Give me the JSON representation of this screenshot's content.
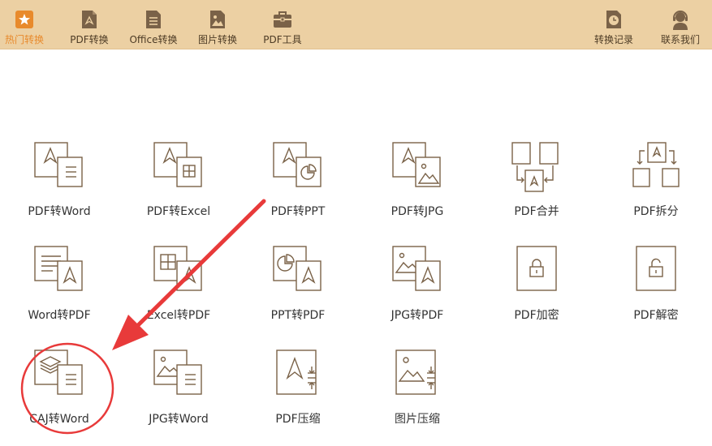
{
  "colors": {
    "topbar_bg": "#ecd0a3",
    "accent": "#e88a2c",
    "icon_stroke": "#7a6248",
    "annotation": "#e83a3a"
  },
  "nav": {
    "hot": {
      "label": "热门转换",
      "icon": "star-icon"
    },
    "pdf_convert": {
      "label": "PDF转换",
      "icon": "pdf-file-icon"
    },
    "office_convert": {
      "label": "Office转换",
      "icon": "document-icon"
    },
    "image_convert": {
      "label": "图片转换",
      "icon": "image-icon"
    },
    "pdf_tools": {
      "label": "PDF工具",
      "icon": "toolbox-icon"
    },
    "history": {
      "label": "转换记录",
      "icon": "clock-icon"
    },
    "contact": {
      "label": "联系我们",
      "icon": "headset-icon"
    }
  },
  "tiles": {
    "pdf_to_word": "PDF转Word",
    "pdf_to_excel": "PDF转Excel",
    "pdf_to_ppt": "PDF转PPT",
    "pdf_to_jpg": "PDF转JPG",
    "pdf_merge": "PDF合并",
    "pdf_split": "PDF拆分",
    "word_to_pdf": "Word转PDF",
    "excel_to_pdf": "Excel转PDF",
    "ppt_to_pdf": "PPT转PDF",
    "jpg_to_pdf": "JPG转PDF",
    "pdf_encrypt": "PDF加密",
    "pdf_decrypt": "PDF解密",
    "caj_to_word": "CAJ转Word",
    "jpg_to_word": "JPG转Word",
    "pdf_compress": "PDF压缩",
    "image_compress": "图片压缩"
  }
}
